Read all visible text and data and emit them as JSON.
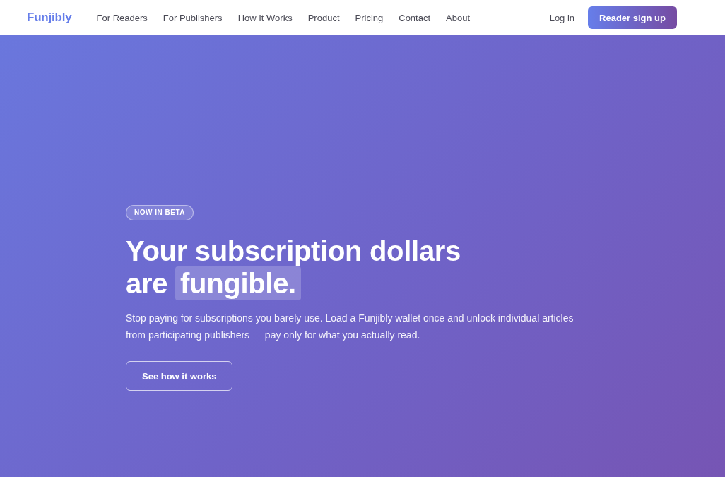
{
  "header": {
    "logo": "Funjibly",
    "nav_links": [
      "For Readers",
      "For Publishers",
      "How It Works",
      "Product",
      "Pricing",
      "Contact",
      "About"
    ],
    "login": "Log in",
    "signup_button": "Reader sign up"
  },
  "hero": {
    "badge": "NOW IN BETA",
    "headline": {
      "text": "Your subscription dollars are",
      "highlight": "fungible."
    },
    "description": "Stop paying for subscriptions you barely use. Load a Funjibly wallet once and unlock individual articles from participating publishers — pay only for what you actually read.",
    "button": "See how it works"
  }
}
